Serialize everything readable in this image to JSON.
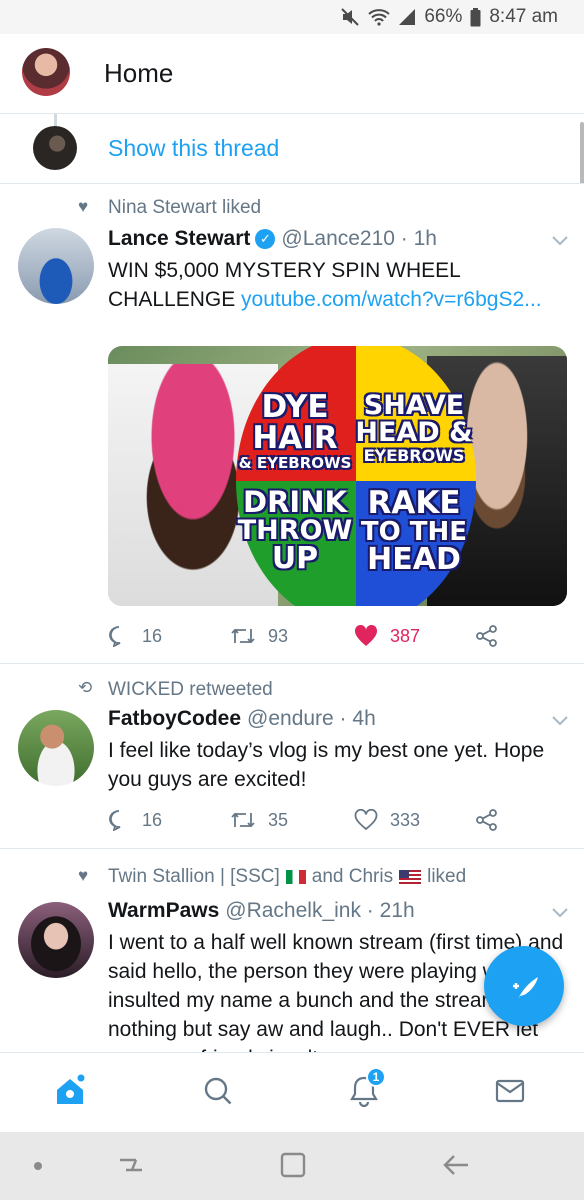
{
  "status_bar": {
    "battery": "66%",
    "time": "8:47 am"
  },
  "header": {
    "title": "Home"
  },
  "thread": {
    "show_thread": "Show this thread"
  },
  "tweets": [
    {
      "social_context": "Nina Stewart liked",
      "name": "Lance Stewart",
      "handle": "@Lance210 · 1h",
      "text": "WIN $5,000 MYSTERY SPIN WHEEL CHALLENGE ",
      "link": "youtube.com/watch?v=r6bgS2...",
      "replies": "16",
      "retweets": "93",
      "likes": "387",
      "media": {
        "q1_line1": "DYE",
        "q1_line2": "HAIR",
        "q1_line3": "& EYEBROWS",
        "q2_line1": "SHAVE",
        "q2_line2": "HEAD &",
        "q2_line3": "EYEBROWS",
        "q3_line1": "DRINK",
        "q3_line2": "THROW",
        "q3_line3": "UP",
        "q4_line1": "RAKE",
        "q4_line2": "TO THE",
        "q4_line3": "HEAD"
      }
    },
    {
      "social_context": "WICKED retweeted",
      "name": "FatboyCodee",
      "handle": "@endure · 4h",
      "text": "I feel like today’s vlog is my best one yet. Hope you guys are excited!",
      "replies": "16",
      "retweets": "35",
      "likes": "333"
    },
    {
      "social_context_a": "Twin Stallion | [SSC]",
      "social_context_b": "and Chris",
      "social_context_c": "liked",
      "name": "WarmPaws",
      "handle": "@Rachelk_ink · 21h",
      "text": "I went to a half well known stream (first time) and said hello, the person they were playing with insulted my name a bunch and the streamer did nothing but say aw and laugh.. Don't EVER let someone friends insult you"
    }
  ],
  "tabbar": {
    "notification_count": "1"
  },
  "colors": {
    "accent": "#1da1f2",
    "like": "#e0245e",
    "muted": "#657786"
  }
}
